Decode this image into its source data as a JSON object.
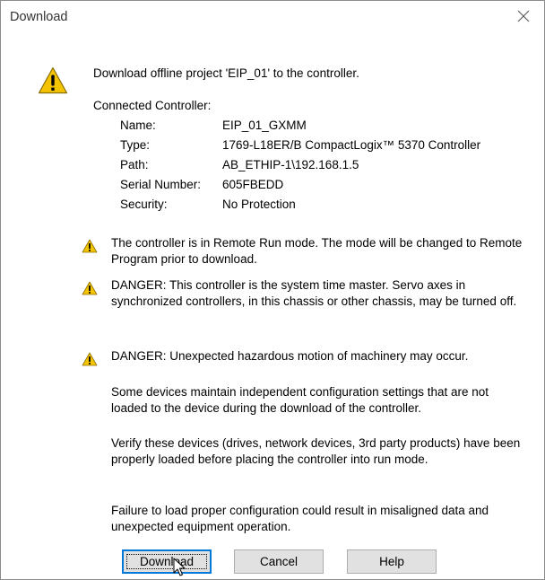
{
  "window": {
    "title": "Download"
  },
  "message": {
    "main": "Download offline project 'EIP_01' to the controller.",
    "connected_label": "Connected Controller:"
  },
  "controller": {
    "rows": [
      {
        "label": "Name:",
        "value": "EIP_01_GXMM"
      },
      {
        "label": "Type:",
        "value": "1769-L18ER/B CompactLogix™ 5370 Controller"
      },
      {
        "label": "Path:",
        "value": "AB_ETHIP-1\\192.168.1.5"
      },
      {
        "label": "Serial Number:",
        "value": "605FBEDD"
      },
      {
        "label": "Security:",
        "value": "No Protection"
      }
    ]
  },
  "warnings": {
    "remote_run": "The controller is in Remote Run mode. The mode will be changed to Remote Program prior to download.",
    "time_master": "DANGER: This controller is the system time master.  Servo axes in synchronized controllers, in this chassis or other chassis, may be turned off.",
    "hazardous": "DANGER: Unexpected hazardous motion of machinery may occur."
  },
  "notes": {
    "devices_config": "Some devices maintain independent configuration settings that are not loaded to the device during the download of the controller.",
    "verify_devices": "Verify these devices (drives, network devices, 3rd party products) have been properly loaded before placing the controller into run mode.",
    "failure": "Failure to load proper configuration could result in misaligned data and unexpected equipment operation."
  },
  "buttons": {
    "download": "Download",
    "cancel": "Cancel",
    "help": "Help"
  },
  "icons": {
    "warning_large": "warning-icon",
    "warning_small": "warning-icon",
    "close": "close-icon",
    "cursor": "mouse-cursor-icon"
  },
  "colors": {
    "warning_yellow": "#f5c400",
    "default_button_border": "#0078d7",
    "button_face": "#e1e1e1"
  }
}
